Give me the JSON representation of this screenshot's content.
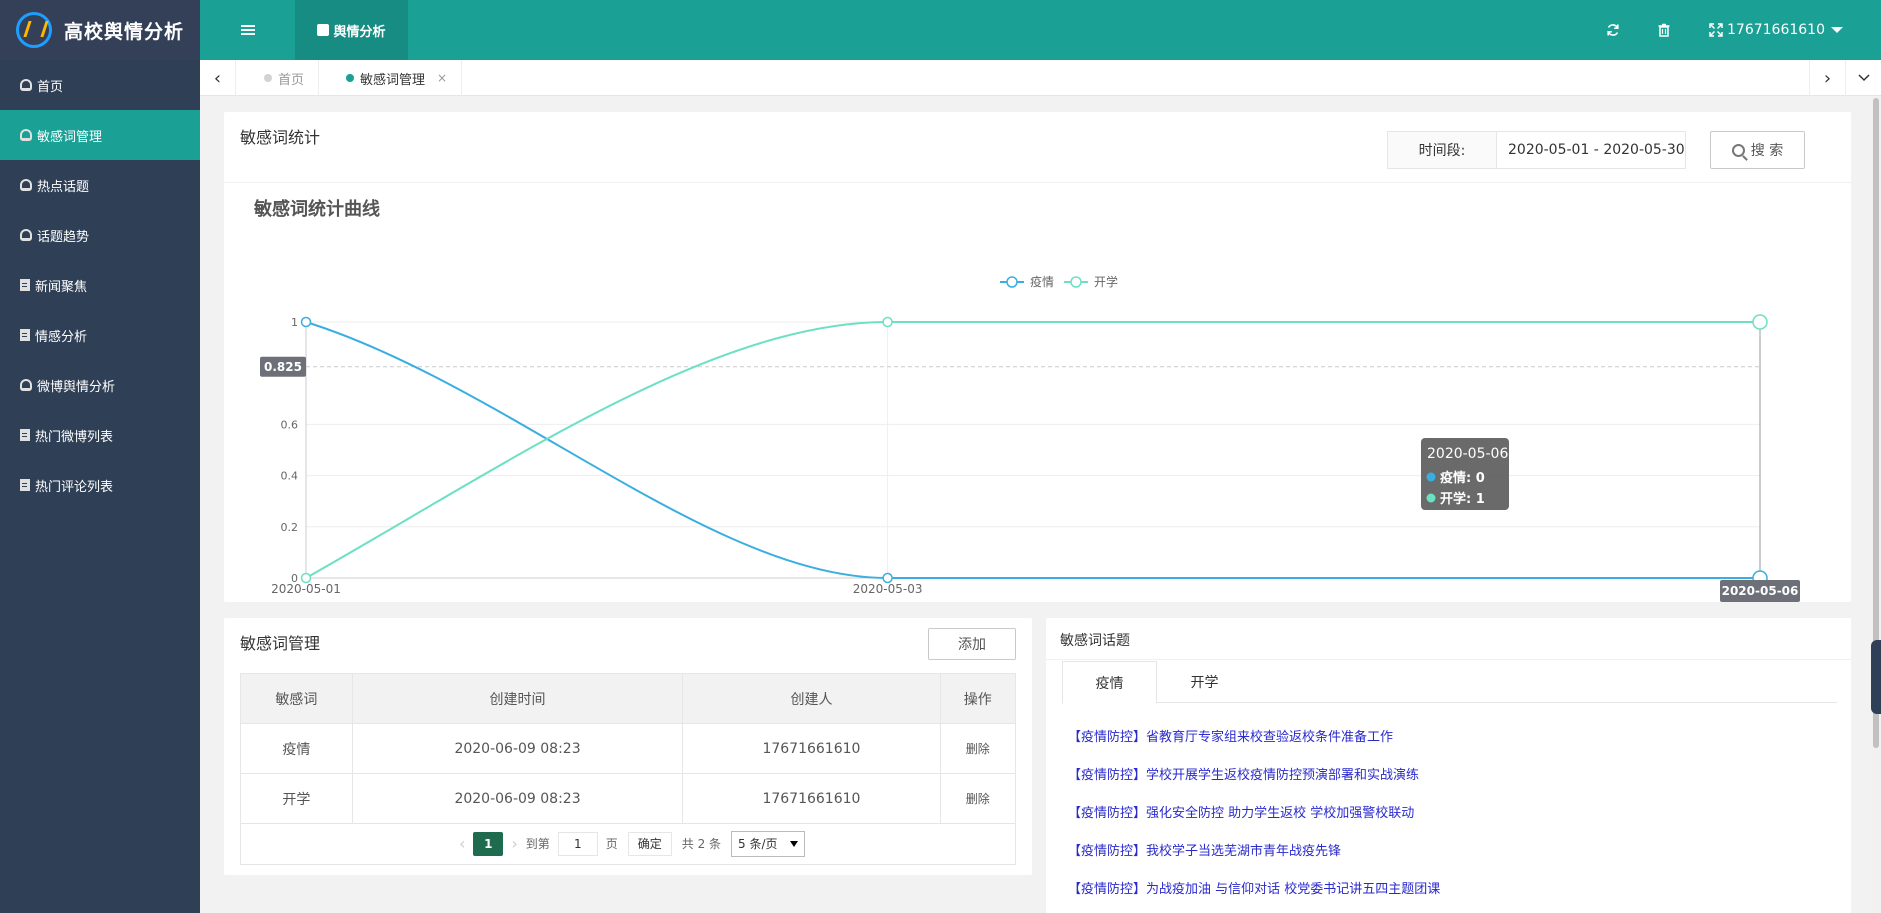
{
  "app": {
    "title": "高校舆情分析"
  },
  "header": {
    "module_tab": "舆情分析",
    "user": "17671661610"
  },
  "sidebar": {
    "items": [
      {
        "label": "首页",
        "icon": "dashboard-icon"
      },
      {
        "label": "敏感词管理",
        "icon": "dashboard-icon"
      },
      {
        "label": "热点话题",
        "icon": "dashboard-icon"
      },
      {
        "label": "话题趋势",
        "icon": "dashboard-icon"
      },
      {
        "label": "新闻聚焦",
        "icon": "file-icon"
      },
      {
        "label": "情感分析",
        "icon": "file-icon"
      },
      {
        "label": "微博舆情分析",
        "icon": "dashboard-icon"
      },
      {
        "label": "热门微博列表",
        "icon": "file-icon"
      },
      {
        "label": "热门评论列表",
        "icon": "file-icon"
      }
    ],
    "active_index": 1
  },
  "tabs": {
    "home": "首页",
    "current": "敏感词管理",
    "close": "×"
  },
  "stats": {
    "title": "敏感词统计",
    "time_label": "时间段:",
    "time_value": "2020-05-01 - 2020-05-30",
    "search_label": "搜 索"
  },
  "chart_data": {
    "type": "line",
    "title": "敏感词统计曲线",
    "x": [
      "2020-05-01",
      "2020-05-03",
      "2020-05-06"
    ],
    "series": [
      {
        "name": "疫情",
        "values": [
          1,
          0,
          0
        ],
        "color": "#3aaee0"
      },
      {
        "name": "开学",
        "values": [
          0,
          1,
          1
        ],
        "color": "#6de0c4"
      }
    ],
    "ylim": [
      0,
      1
    ],
    "yticks": [
      "0",
      "0.2",
      "0.4",
      "0.6",
      "1"
    ],
    "legend": "top-center",
    "grid": true,
    "pointer_value": "0.825",
    "pointer_x_label": "2020-05-06",
    "tooltip": {
      "title": "2020-05-06",
      "rows": [
        "疫情: 0",
        "开学: 1"
      ]
    }
  },
  "manage": {
    "title": "敏感词管理",
    "add_label": "添加",
    "columns": [
      "敏感词",
      "创建时间",
      "创建人",
      "操作"
    ],
    "rows": [
      {
        "word": "疫情",
        "time": "2020-06-09 08:23",
        "creator": "17671661610",
        "action": "删除"
      },
      {
        "word": "开学",
        "time": "2020-06-09 08:23",
        "creator": "17671661610",
        "action": "删除"
      }
    ],
    "pager": {
      "current": "1",
      "goto_label": "到第",
      "page_input": "1",
      "page_unit": "页",
      "confirm": "确定",
      "total": "共 2 条",
      "page_size": "5 条/页"
    }
  },
  "topics": {
    "title": "敏感词话题",
    "tabs": [
      "疫情",
      "开学"
    ],
    "items": [
      "【疫情防控】省教育厅专家组来校查验返校条件准备工作",
      "【疫情防控】学校开展学生返校疫情防控预演部署和实战演练",
      "【疫情防控】强化安全防控 助力学生返校 学校加强警校联动",
      "【疫情防控】我校学子当选芜湖市青年战疫先锋",
      "【疫情防控】为战疫加油 与信仰对话 校党委书记讲五四主题团课"
    ]
  }
}
